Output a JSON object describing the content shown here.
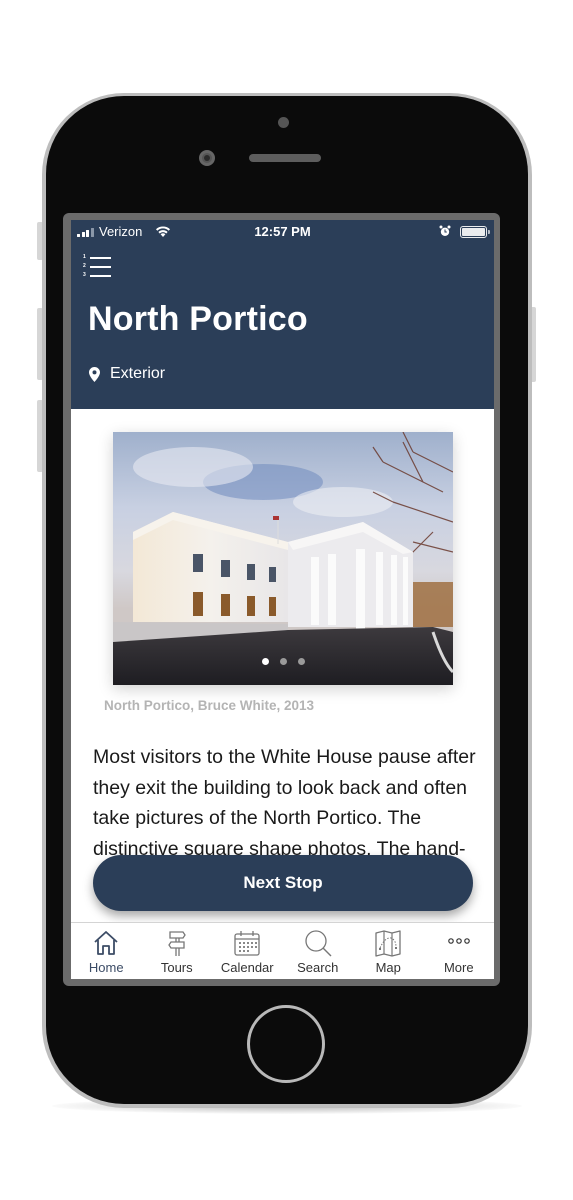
{
  "status_bar": {
    "carrier": "Verizon",
    "time": "12:57 PM",
    "icons": [
      "signal-icon",
      "wifi-icon",
      "alarm-icon",
      "battery-icon"
    ]
  },
  "header": {
    "menu_numbers": [
      "1",
      "2",
      "3"
    ],
    "title": "North Portico",
    "location_icon": "map-pin-icon",
    "location": "Exterior",
    "background_color": "#2b3e58"
  },
  "carousel": {
    "photo_alt": "North Portico of the White House at sunset",
    "total_slides": 3,
    "active_slide": 1,
    "caption": "North Portico, Bruce White, 2013"
  },
  "body": {
    "text": "Most visitors to the White House pause after they exit the building to look back and often take pictures of the North Portico. The distinctive square shape photos. The hand-carved Aquia"
  },
  "next_stop_button": {
    "label": "Next Stop",
    "color": "#2b3e58"
  },
  "tab_bar": {
    "items": [
      {
        "label": "Home",
        "icon": "home-icon",
        "active": true
      },
      {
        "label": "Tours",
        "icon": "signpost-icon",
        "active": false
      },
      {
        "label": "Calendar",
        "icon": "calendar-icon",
        "active": false
      },
      {
        "label": "Search",
        "icon": "search-icon",
        "active": false
      },
      {
        "label": "Map",
        "icon": "map-icon",
        "active": false
      },
      {
        "label": "More",
        "icon": "more-icon",
        "active": false
      }
    ]
  }
}
